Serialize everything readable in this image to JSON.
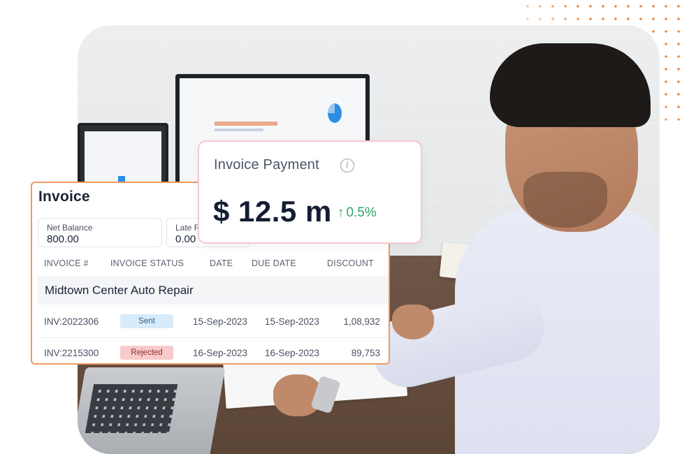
{
  "invoice_card": {
    "title": "Invoice",
    "net_balance": {
      "label": "Net Balance",
      "value": "800.00"
    },
    "late_fee": {
      "label": "Late F",
      "value": "0.00"
    },
    "columns": [
      "INVOICE #",
      "INVOICE STATUS",
      "DATE",
      "DUE DATE",
      "DISCOUNT"
    ],
    "group": "Midtown Center Auto Repair",
    "rows": [
      {
        "invoice": "INV:2022306",
        "status": "Sent",
        "date": "15-Sep-2023",
        "due_date": "15-Sep-2023",
        "discount": "1,08,932"
      },
      {
        "invoice": "INV:2215300",
        "status": "Rejected",
        "date": "16-Sep-2023",
        "due_date": "16-Sep-2023",
        "discount": "89,753"
      }
    ]
  },
  "payment_card": {
    "title": "Invoice Payment",
    "info_icon": "info-icon",
    "amount": "$ 12.5 m",
    "change_arrow": "↑",
    "change": "0.5%"
  },
  "colors": {
    "invoice_border": "#ee9a62",
    "payment_border": "#f7c8d3",
    "positive": "#2aa56a",
    "sent_badge": "#d7ebfb",
    "rejected_badge": "#f9caca",
    "dots": "#f08a3c"
  }
}
